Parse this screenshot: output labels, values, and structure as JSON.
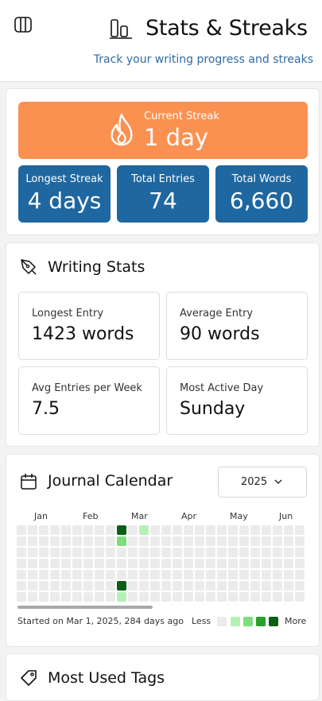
{
  "header": {
    "title": "Stats & Streaks",
    "subtitle": "Track your writing progress and streaks"
  },
  "streaks": {
    "current_label": "Current Streak",
    "current_value": "1 day",
    "cards": [
      {
        "label": "Longest Streak",
        "value": "4 days"
      },
      {
        "label": "Total Entries",
        "value": "74"
      },
      {
        "label": "Total Words",
        "value": "6,660"
      }
    ]
  },
  "writing_stats": {
    "title": "Writing Stats",
    "items": [
      {
        "label": "Longest Entry",
        "value": "1423 words"
      },
      {
        "label": "Average Entry",
        "value": "90 words"
      },
      {
        "label": "Avg Entries per Week",
        "value": "7.5"
      },
      {
        "label": "Most Active Day",
        "value": "Sunday"
      }
    ]
  },
  "calendar": {
    "title": "Journal Calendar",
    "year": "2025",
    "months": [
      "Jan",
      "Feb",
      "Mar",
      "Apr",
      "May",
      "Jun"
    ],
    "footer": "Started on Mar 1, 2025, 284 days ago",
    "legend_less": "Less",
    "legend_more": "More",
    "colors": {
      "empty": "#ebebeb",
      "level1": "#b5f0b5",
      "level2": "#7ddd7d",
      "level3": "#2aa02a",
      "level4": "#0b5e14"
    },
    "activity": [
      {
        "week": 9,
        "day": 0,
        "level": 4
      },
      {
        "week": 9,
        "day": 1,
        "level": 2
      },
      {
        "week": 9,
        "day": 5,
        "level": 4
      },
      {
        "week": 9,
        "day": 6,
        "level": 1
      },
      {
        "week": 11,
        "day": 0,
        "level": 1
      }
    ]
  },
  "tags": {
    "title": "Most Used Tags"
  }
}
